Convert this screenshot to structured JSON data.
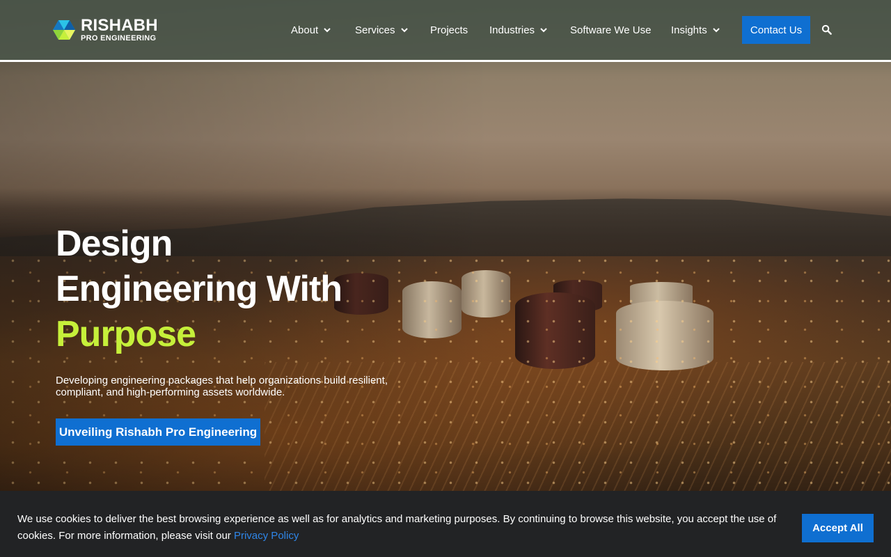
{
  "brand": {
    "name_line1": "RISHABH",
    "name_line2": "PRO ENGINEERING",
    "accent_color": "#c6f03a",
    "button_color": "#0f6fd1"
  },
  "nav": {
    "items": [
      {
        "label": "About",
        "has_dropdown": true
      },
      {
        "label": "Services",
        "has_dropdown": true
      },
      {
        "label": "Projects",
        "has_dropdown": false
      },
      {
        "label": "Industries",
        "has_dropdown": true
      },
      {
        "label": "Software We Use",
        "has_dropdown": false
      },
      {
        "label": "Insights",
        "has_dropdown": true
      }
    ],
    "contact_label": "Contact Us",
    "search_icon": "search-icon"
  },
  "hero": {
    "title_line1": "Design",
    "title_line2": "Engineering With",
    "title_accent": "Purpose",
    "subtitle": "Developing engineering packages that help organizations build resilient, compliant, and high-performing assets worldwide.",
    "cta_label": "Unveiling Rishabh Pro Engineering"
  },
  "cookie": {
    "text": "We use cookies to deliver the best browsing experience as well as for analytics and marketing purposes. By continuing to browse this website, you accept the use of cookies. For more information, please visit our ",
    "link_label": "Privacy Policy",
    "accept_label": "Accept All"
  }
}
